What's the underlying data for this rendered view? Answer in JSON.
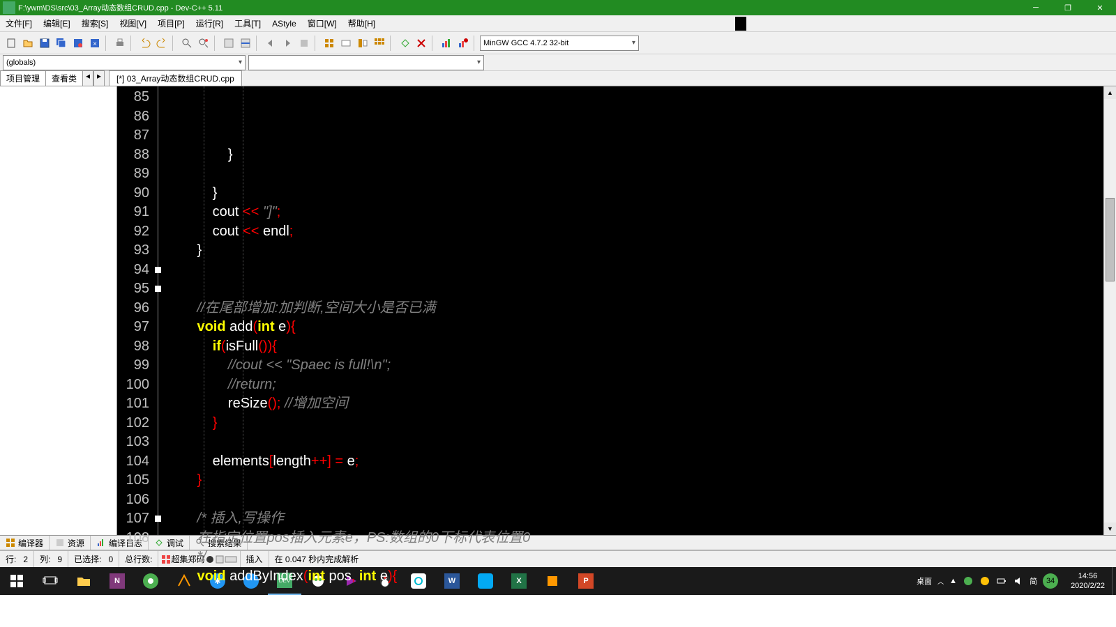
{
  "window": {
    "title": "F:\\ywm\\DS\\src\\03_Array动态数组CRUD.cpp - Dev-C++ 5.11"
  },
  "menu": {
    "file": "文件[F]",
    "edit": "编辑[E]",
    "search": "搜索[S]",
    "view": "视图[V]",
    "project": "项目[P]",
    "run": "运行[R]",
    "tools": "工具[T]",
    "astyle": "AStyle",
    "window": "窗口[W]",
    "help": "帮助[H]"
  },
  "toolbar": {
    "compiler_combo": "MinGW GCC 4.7.2 32-bit"
  },
  "scope_combo": "(globals)",
  "member_combo": "",
  "side_tabs": {
    "project": "项目管理",
    "classes": "查看类"
  },
  "file_tab": "[*] 03_Array动态数组CRUD.cpp",
  "code_lines": [
    {
      "n": 85,
      "html": "                }"
    },
    {
      "n": 86,
      "html": ""
    },
    {
      "n": 87,
      "html": "            }"
    },
    {
      "n": 88,
      "html": "            cout <span class='sym'>&lt;&lt;</span> <span class='str'>\"]\"</span><span class='sym'>;</span>"
    },
    {
      "n": 89,
      "html": "            cout <span class='sym'>&lt;&lt;</span> endl<span class='sym'>;</span>"
    },
    {
      "n": 90,
      "html": "        }"
    },
    {
      "n": 91,
      "html": ""
    },
    {
      "n": 92,
      "html": ""
    },
    {
      "n": 93,
      "html": "        <span class='cm'>//在尾部增加:加判断,空间大小是否已满</span>"
    },
    {
      "n": 94,
      "html": "        <span class='kw'>void</span> add<span class='sym'>(</span><span class='kw'>int</span> e<span class='sym'>){</span>",
      "fold": true
    },
    {
      "n": 95,
      "html": "            <span class='kw'>if</span><span class='sym'>(</span>isFull<span class='sym'>()){</span>",
      "fold": true
    },
    {
      "n": 96,
      "html": "                <span class='cm'>//cout &lt;&lt; \"Spaec is full!\\n\";</span>"
    },
    {
      "n": 97,
      "html": "                <span class='cm'>//return;</span>"
    },
    {
      "n": 98,
      "html": "                reSize<span class='sym'>();</span> <span class='cm'>//增加空间</span>"
    },
    {
      "n": 99,
      "html": "            <span class='sym'>}</span>"
    },
    {
      "n": 100,
      "html": ""
    },
    {
      "n": 101,
      "html": "            elements<span class='sym'>[</span>length<span class='sym'>++] =</span> e<span class='sym'>;</span>"
    },
    {
      "n": 102,
      "html": "        <span class='sym'>}</span>"
    },
    {
      "n": 103,
      "html": ""
    },
    {
      "n": 104,
      "html": "        <span class='cm'>/* 插入,写操作</span>"
    },
    {
      "n": 105,
      "html": "        <span class='cm'>在指定位置pos插入元素e，PS:数组的0下标代表位置0</span>"
    },
    {
      "n": 106,
      "html": "        <span class='cm'>*/</span>"
    },
    {
      "n": 107,
      "html": "        <span class='kw'>void</span> addByIndex<span class='sym'>(</span><span class='kw'>int</span> pos<span class='sym'>,</span> <span class='kw'>int</span> e<span class='sym'>){</span>",
      "fold": true
    },
    {
      "n": 108,
      "html": ""
    }
  ],
  "bottom_tabs": {
    "compiler": "编译器",
    "res": "资源",
    "log": "编译日志",
    "debug": "调试",
    "results": "搜索结果"
  },
  "status": {
    "line_lbl": "行:",
    "line": "2",
    "col_lbl": "列:",
    "col": "9",
    "sel_lbl": "已选择:",
    "sel": "0",
    "total_lbl": "总行数:",
    "encoding": "超集郑码",
    "ins": "插入",
    "parse": "在 0.047 秒内完成解析"
  },
  "tray": {
    "desktop": "桌面",
    "ime": "简",
    "badge": "34",
    "time": "14:56",
    "date": "2020/2/22"
  }
}
